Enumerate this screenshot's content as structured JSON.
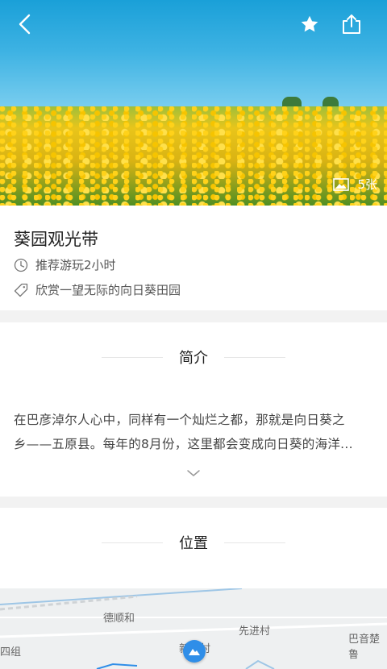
{
  "hero": {
    "photo_count": "5张",
    "icons": {
      "back": "back-arrow-icon",
      "favorite": "star-icon",
      "share": "share-icon",
      "photo": "image-icon"
    }
  },
  "info": {
    "title": "葵园观光带",
    "duration": "推荐游玩2小时",
    "tagline": "欣赏一望无际的向日葵田园",
    "icons": {
      "duration": "clock-icon",
      "tagline": "tag-icon"
    }
  },
  "intro": {
    "heading": "简介",
    "lines": [
      "在巴彦淖尔人心中，同样有一个灿烂之都，那就是向日葵之",
      "乡——五原县。每年的8月份，这里都会变成向日葵的海洋..."
    ],
    "expand_icon": "chevron-down-icon"
  },
  "location": {
    "heading": "位置"
  },
  "map": {
    "labels": [
      "德顺和",
      "先进村",
      "巴音楚鲁",
      "四组",
      "新丰村"
    ],
    "pin_icon": "location-pin-icon"
  },
  "colors": {
    "accent": "#2f8ee8",
    "background": "#f2f2f2"
  }
}
